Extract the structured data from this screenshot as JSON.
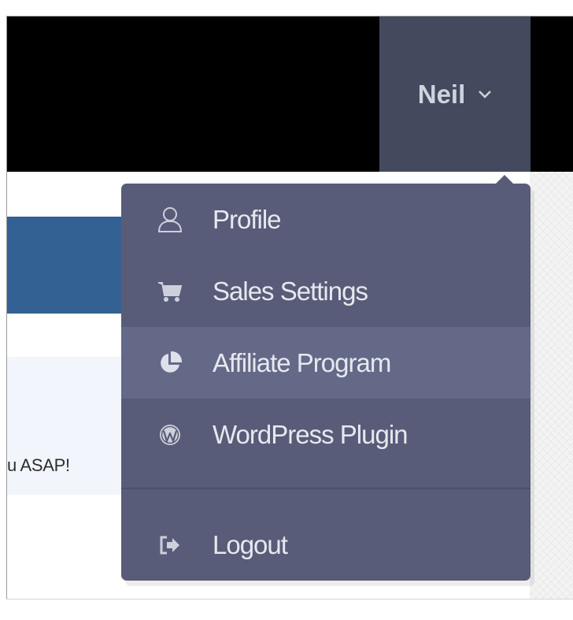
{
  "navbar": {
    "user_name": "Neil"
  },
  "notice": {
    "text": "u ASAP!"
  },
  "dropdown": {
    "items": [
      {
        "label": "Profile",
        "icon": "user-icon"
      },
      {
        "label": "Sales Settings",
        "icon": "cart-icon"
      },
      {
        "label": "Affiliate Program",
        "icon": "pie-chart-icon",
        "active": true
      },
      {
        "label": "WordPress Plugin",
        "icon": "wordpress-icon"
      }
    ],
    "logout": {
      "label": "Logout",
      "icon": "sign-out-icon"
    }
  },
  "colors": {
    "navbar_bg": "#000000",
    "toggle_bg": "#434a5e",
    "dropdown_bg": "#585c78",
    "dropdown_active_bg": "#646988",
    "banner_blue": "#336194"
  }
}
